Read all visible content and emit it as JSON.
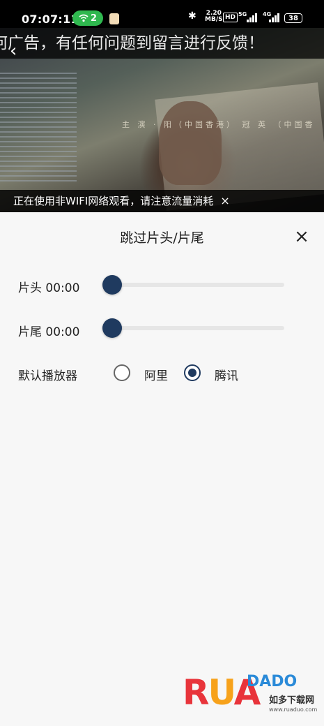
{
  "status_bar": {
    "time": "07:07:11",
    "wifi_badge": "2",
    "net_speed_value": "2.20",
    "net_speed_unit": "MB/S",
    "hd_label": "HD",
    "signal1_label": "5G",
    "signal2_label": "4G",
    "battery": "38"
  },
  "video": {
    "banner_text": "何广告，有任何问题到留言进行反馈！",
    "embedded_caption": "主 演 · 阳（中国香港）  冠 英  （中国香",
    "network_warning": "正在使用非WIFI网络观看，请注意流量消耗",
    "warning_close": "×",
    "back_icon": "‹"
  },
  "panel": {
    "title": "跳过片头/片尾",
    "close": "×",
    "intro_label": "片头 00:00",
    "intro_value_fraction": 0,
    "outro_label": "片尾 00:00",
    "outro_value_fraction": 0,
    "player_label": "默认播放器",
    "players": [
      {
        "label": "阿里",
        "checked": false
      },
      {
        "label": "腾讯",
        "checked": true
      }
    ],
    "accent_color": "#1f3a5f"
  },
  "watermark": {
    "logo_text_r": "R",
    "logo_text_u": "U",
    "logo_text_a": "A",
    "logo_text_small": "DADO",
    "logo_cn": "如多下载网",
    "logo_url": "www.ruaduo.com"
  }
}
